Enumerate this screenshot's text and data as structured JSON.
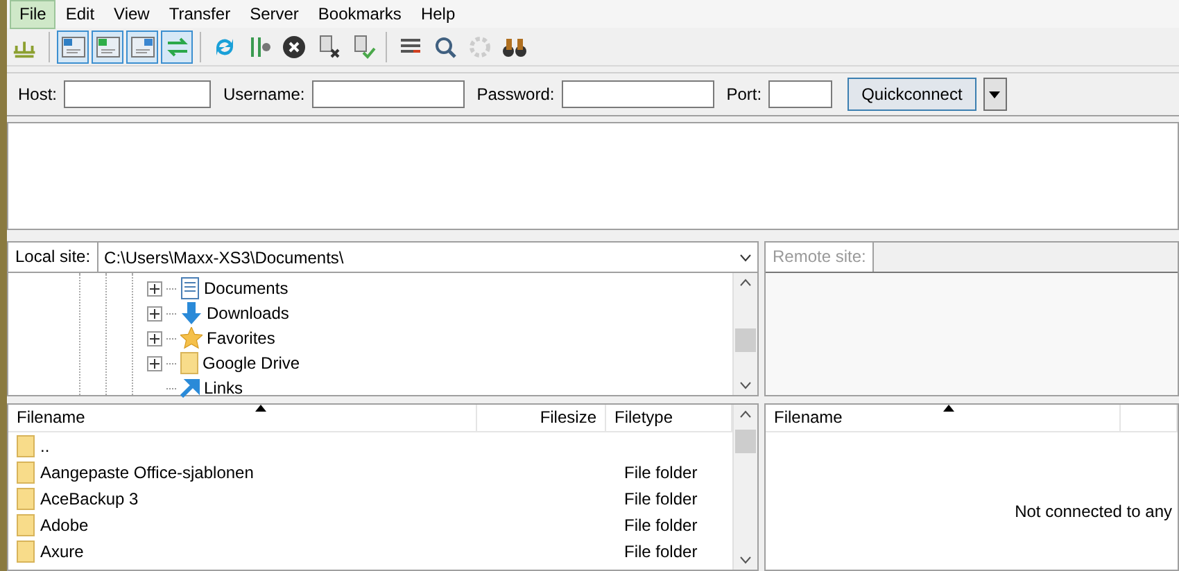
{
  "menu": [
    {
      "label": "File",
      "selected": true
    },
    {
      "label": "Edit",
      "selected": false
    },
    {
      "label": "View",
      "selected": false
    },
    {
      "label": "Transfer",
      "selected": false
    },
    {
      "label": "Server",
      "selected": false
    },
    {
      "label": "Bookmarks",
      "selected": false
    },
    {
      "label": "Help",
      "selected": false
    }
  ],
  "toolbar": [
    {
      "kind": "sitemanager",
      "selected": false,
      "disabled": false
    },
    {
      "kind": "log",
      "selected": true,
      "disabled": false
    },
    {
      "kind": "localtree",
      "selected": true,
      "disabled": false
    },
    {
      "kind": "remotetree",
      "selected": true,
      "disabled": false
    },
    {
      "kind": "queue",
      "selected": true,
      "disabled": false
    },
    {
      "kind": "refresh",
      "selected": false,
      "disabled": false
    },
    {
      "kind": "filters",
      "selected": false,
      "disabled": false
    },
    {
      "kind": "cancel",
      "selected": false,
      "disabled": false
    },
    {
      "kind": "disconnect",
      "selected": false,
      "disabled": false
    },
    {
      "kind": "reconnect",
      "selected": false,
      "disabled": false
    },
    {
      "kind": "compare",
      "selected": false,
      "disabled": false
    },
    {
      "kind": "search",
      "selected": false,
      "disabled": false
    },
    {
      "kind": "sync",
      "selected": false,
      "disabled": true
    },
    {
      "kind": "find",
      "selected": false,
      "disabled": false
    }
  ],
  "quickconnect": {
    "host_label": "Host:",
    "username_label": "Username:",
    "password_label": "Password:",
    "port_label": "Port:",
    "button": "Quickconnect"
  },
  "local": {
    "site_label": "Local site:",
    "path": "C:\\Users\\Maxx-XS3\\Documents\\",
    "tree": [
      {
        "label": "Documents",
        "kind": "document",
        "expandable": true
      },
      {
        "label": "Downloads",
        "kind": "download",
        "expandable": true
      },
      {
        "label": "Favorites",
        "kind": "star",
        "expandable": true
      },
      {
        "label": "Google Drive",
        "kind": "folder",
        "expandable": true
      },
      {
        "label": "Links",
        "kind": "link",
        "expandable": false
      }
    ],
    "columns": [
      "Filename",
      "Filesize",
      "Filetype"
    ],
    "rows": [
      {
        "name": ".."
      },
      {
        "name": "Aangepaste Office-sjablonen",
        "type": "File folder"
      },
      {
        "name": "AceBackup 3",
        "type": "File folder"
      },
      {
        "name": "Adobe",
        "type": "File folder"
      },
      {
        "name": "Axure",
        "type": "File folder"
      }
    ]
  },
  "remote": {
    "site_label": "Remote site:",
    "columns": [
      "Filename"
    ],
    "message": "Not connected to any"
  }
}
